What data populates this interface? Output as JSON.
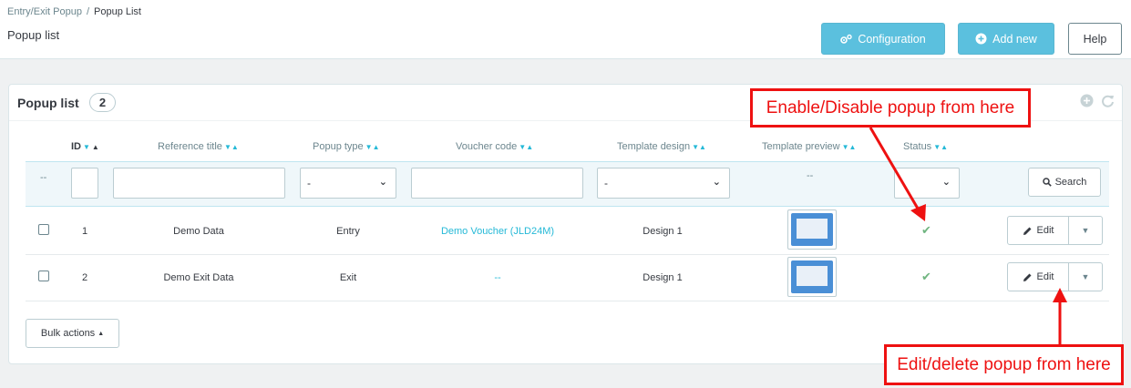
{
  "breadcrumb": {
    "parent": "Entry/Exit Popup",
    "separator": "/",
    "current": "Popup List"
  },
  "page": {
    "title": "Popup list"
  },
  "toolbar": {
    "configuration_label": "Configuration",
    "add_new_label": "Add new",
    "help_label": "Help"
  },
  "panel": {
    "title": "Popup list",
    "count": "2"
  },
  "table": {
    "columns": [
      {
        "key": "id",
        "label": "ID"
      },
      {
        "key": "reference_title",
        "label": "Reference title"
      },
      {
        "key": "popup_type",
        "label": "Popup type"
      },
      {
        "key": "voucher_code",
        "label": "Voucher code"
      },
      {
        "key": "template_design",
        "label": "Template design"
      },
      {
        "key": "template_preview",
        "label": "Template preview"
      },
      {
        "key": "status",
        "label": "Status"
      }
    ],
    "filters": {
      "checkbox_placeholder": "--",
      "id_value": "",
      "reference_title_value": "",
      "popup_type_selected": "-",
      "voucher_code_value": "",
      "template_design_selected": "-",
      "template_preview_placeholder": "--",
      "status_selected": "",
      "search_label": "Search"
    },
    "rows": [
      {
        "id": "1",
        "reference_title": "Demo Data",
        "popup_type": "Entry",
        "voucher_code": "Demo Voucher (JLD24M)",
        "template_design": "Design 1",
        "status": "enabled",
        "edit_label": "Edit"
      },
      {
        "id": "2",
        "reference_title": "Demo Exit Data",
        "popup_type": "Exit",
        "voucher_code": "--",
        "template_design": "Design 1",
        "status": "enabled",
        "edit_label": "Edit"
      }
    ]
  },
  "bulk_actions": {
    "label": "Bulk actions"
  },
  "annotations": {
    "status_callout": "Enable/Disable popup from here",
    "edit_callout": "Edit/delete popup from here"
  },
  "colors": {
    "accent": "#25b9d7",
    "button_blue": "#5bc0de",
    "status_ok": "#70b580",
    "callout_red": "#ee1111"
  },
  "icons": {
    "configuration": "gears-icon",
    "add_new": "plus-circle-icon",
    "panel_add": "add-circle-icon",
    "panel_refresh": "refresh-icon",
    "search": "search-icon",
    "edit": "pencil-icon",
    "status": "check-icon",
    "dropdown": "caret-down-icon"
  }
}
